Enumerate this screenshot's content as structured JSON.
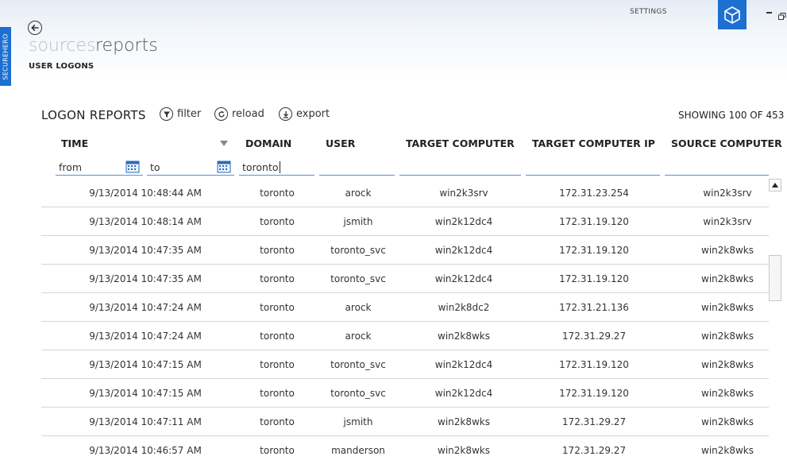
{
  "app": {
    "side_tab": "SECUREHERO",
    "settings_label": "SETTINGS"
  },
  "nav": {
    "sources": "sources",
    "reports": "reports",
    "subtitle": "USER LOGONS"
  },
  "toolbar": {
    "title": "LOGON REPORTS",
    "filter": "filter",
    "reload": "reload",
    "export": "export",
    "showing": "SHOWING 100 OF 453"
  },
  "columns": [
    "TIME",
    "DOMAIN",
    "USER",
    "TARGET COMPUTER",
    "TARGET COMPUTER IP",
    "SOURCE COMPUTER"
  ],
  "filters": {
    "from_placeholder": "from",
    "to_placeholder": "to",
    "domain_value": "toronto"
  },
  "rows": [
    [
      "9/13/2014 10:48:44 AM",
      "toronto",
      "arock",
      "win2k3srv",
      "172.31.23.254",
      "win2k3srv"
    ],
    [
      "9/13/2014 10:48:14 AM",
      "toronto",
      "jsmith",
      "win2k12dc4",
      "172.31.19.120",
      "win2k3srv"
    ],
    [
      "9/13/2014 10:47:35 AM",
      "toronto",
      "toronto_svc",
      "win2k12dc4",
      "172.31.19.120",
      "win2k8wks"
    ],
    [
      "9/13/2014 10:47:35 AM",
      "toronto",
      "toronto_svc",
      "win2k12dc4",
      "172.31.19.120",
      "win2k8wks"
    ],
    [
      "9/13/2014 10:47:24 AM",
      "toronto",
      "arock",
      "win2k8dc2",
      "172.31.21.136",
      "win2k8wks"
    ],
    [
      "9/13/2014 10:47:24 AM",
      "toronto",
      "arock",
      "win2k8wks",
      "172.31.29.27",
      "win2k8wks"
    ],
    [
      "9/13/2014 10:47:15 AM",
      "toronto",
      "toronto_svc",
      "win2k12dc4",
      "172.31.19.120",
      "win2k8wks"
    ],
    [
      "9/13/2014 10:47:15 AM",
      "toronto",
      "toronto_svc",
      "win2k12dc4",
      "172.31.19.120",
      "win2k8wks"
    ],
    [
      "9/13/2014 10:47:11 AM",
      "toronto",
      "jsmith",
      "win2k8wks",
      "172.31.29.27",
      "win2k8wks"
    ],
    [
      "9/13/2014 10:46:57 AM",
      "toronto",
      "manderson",
      "win2k8wks",
      "172.31.29.27",
      "win2k8wks"
    ]
  ],
  "colors": {
    "accent": "#1d6fd1",
    "filter_underline": "#5a8fd6",
    "row_divider": "#d4d4d4"
  }
}
